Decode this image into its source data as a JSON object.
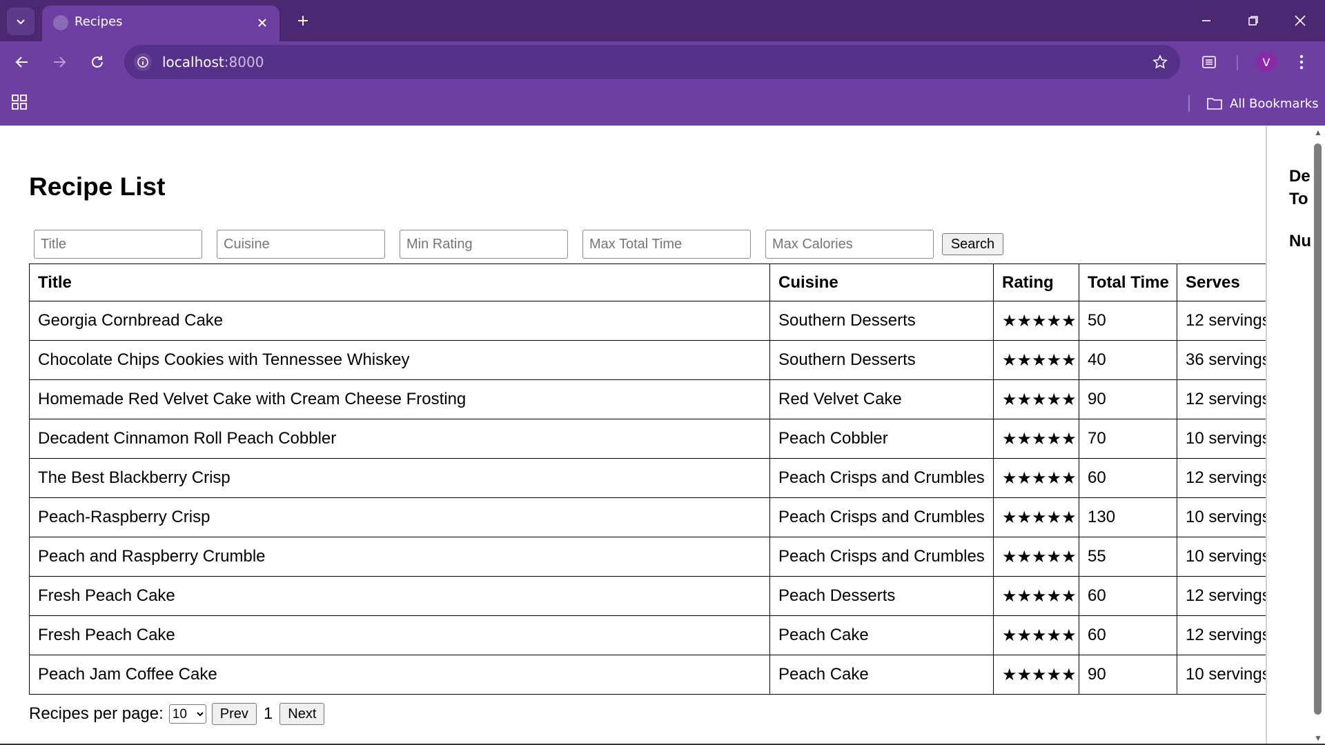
{
  "browser": {
    "tab_title": "Recipes",
    "url_host": "localhost",
    "url_port": ":8000",
    "avatar_initial": "V",
    "all_bookmarks": "All Bookmarks",
    "theme_colors": {
      "frame": "#4b2871",
      "toolbar": "#6e3fa3",
      "omnibox": "#56318a"
    }
  },
  "page": {
    "title": "Recipe List",
    "filters": {
      "title_placeholder": "Title",
      "cuisine_placeholder": "Cuisine",
      "min_rating_placeholder": "Min Rating",
      "max_total_time_placeholder": "Max Total Time",
      "max_calories_placeholder": "Max Calories",
      "search_label": "Search"
    },
    "table": {
      "headers": [
        "Title",
        "Cuisine",
        "Rating",
        "Total Time",
        "Serves"
      ],
      "rows": [
        {
          "title": "Georgia Cornbread Cake",
          "cuisine": "Southern Desserts",
          "rating": "★★★★★",
          "total_time": "50",
          "serves": "12 servings"
        },
        {
          "title": "Chocolate Chips Cookies with Tennessee Whiskey",
          "cuisine": "Southern Desserts",
          "rating": "★★★★★",
          "total_time": "40",
          "serves": "36 servings"
        },
        {
          "title": "Homemade Red Velvet Cake with Cream Cheese Frosting",
          "cuisine": "Red Velvet Cake",
          "rating": "★★★★★",
          "total_time": "90",
          "serves": "12 servings"
        },
        {
          "title": "Decadent Cinnamon Roll Peach Cobbler",
          "cuisine": "Peach Cobbler",
          "rating": "★★★★★",
          "total_time": "70",
          "serves": "10 servings"
        },
        {
          "title": "The Best Blackberry Crisp",
          "cuisine": "Peach Crisps and Crumbles",
          "rating": "★★★★★",
          "total_time": "60",
          "serves": "12 servings"
        },
        {
          "title": "Peach-Raspberry Crisp",
          "cuisine": "Peach Crisps and Crumbles",
          "rating": "★★★★★",
          "total_time": "130",
          "serves": "10 servings"
        },
        {
          "title": "Peach and Raspberry Crumble",
          "cuisine": "Peach Crisps and Crumbles",
          "rating": "★★★★★",
          "total_time": "55",
          "serves": "10 servings"
        },
        {
          "title": "Fresh Peach Cake",
          "cuisine": "Peach Desserts",
          "rating": "★★★★★",
          "total_time": "60",
          "serves": "12 servings"
        },
        {
          "title": "Fresh Peach Cake",
          "cuisine": "Peach Cake",
          "rating": "★★★★★",
          "total_time": "60",
          "serves": "12 servings"
        },
        {
          "title": "Peach Jam Coffee Cake",
          "cuisine": "Peach Cake",
          "rating": "★★★★★",
          "total_time": "90",
          "serves": "10 servings"
        }
      ]
    },
    "pagination": {
      "per_page_label": "Recipes per page:",
      "per_page_value": "10",
      "prev_label": "Prev",
      "page_number": "1",
      "next_label": "Next"
    },
    "side_panel": {
      "line1": "De",
      "line2": "To",
      "line3": "Nu"
    }
  }
}
